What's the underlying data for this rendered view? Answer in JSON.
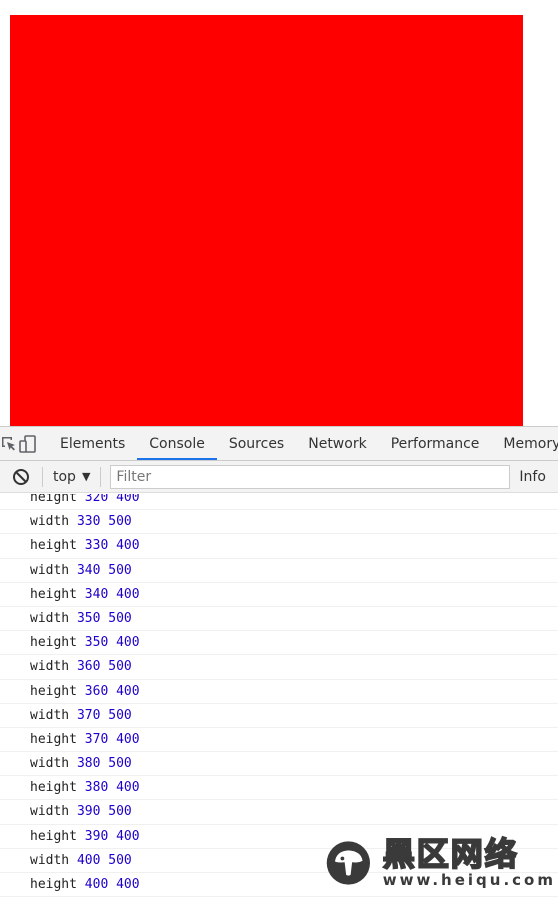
{
  "viewport": {
    "box_color": "#ff0000"
  },
  "devtools": {
    "tabs": [
      {
        "label": "Elements",
        "active": false
      },
      {
        "label": "Console",
        "active": true
      },
      {
        "label": "Sources",
        "active": false
      },
      {
        "label": "Network",
        "active": false
      },
      {
        "label": "Performance",
        "active": false
      },
      {
        "label": "Memory",
        "active": false
      }
    ],
    "toolbar": {
      "context": "top",
      "filter_placeholder": "Filter",
      "levels": "Info"
    },
    "console_lines": [
      {
        "label": "height",
        "a": "320",
        "b": "400"
      },
      {
        "label": "width",
        "a": "330",
        "b": "500"
      },
      {
        "label": "height",
        "a": "330",
        "b": "400"
      },
      {
        "label": "width",
        "a": "340",
        "b": "500"
      },
      {
        "label": "height",
        "a": "340",
        "b": "400"
      },
      {
        "label": "width",
        "a": "350",
        "b": "500"
      },
      {
        "label": "height",
        "a": "350",
        "b": "400"
      },
      {
        "label": "width",
        "a": "360",
        "b": "500"
      },
      {
        "label": "height",
        "a": "360",
        "b": "400"
      },
      {
        "label": "width",
        "a": "370",
        "b": "500"
      },
      {
        "label": "height",
        "a": "370",
        "b": "400"
      },
      {
        "label": "width",
        "a": "380",
        "b": "500"
      },
      {
        "label": "height",
        "a": "380",
        "b": "400"
      },
      {
        "label": "width",
        "a": "390",
        "b": "500"
      },
      {
        "label": "height",
        "a": "390",
        "b": "400"
      },
      {
        "label": "width",
        "a": "400",
        "b": "500"
      },
      {
        "label": "height",
        "a": "400",
        "b": "400"
      }
    ]
  },
  "watermark": {
    "title": "黑区网络",
    "url": "www.heiqu.com"
  }
}
